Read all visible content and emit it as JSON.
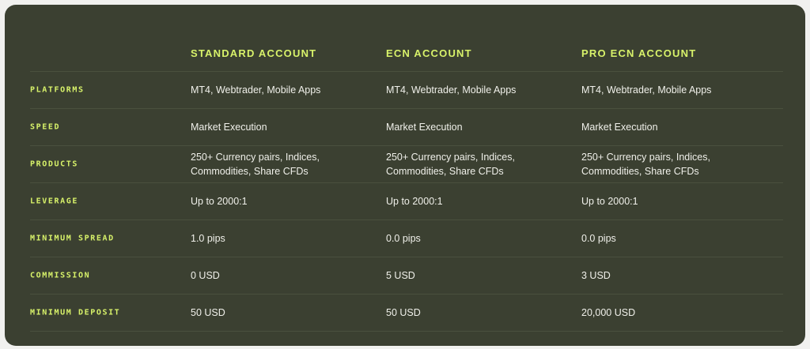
{
  "columns": [
    "STANDARD ACCOUNT",
    "ECN ACCOUNT",
    "PRO ECN ACCOUNT"
  ],
  "rows": [
    {
      "label": "PLATFORMS",
      "values": [
        "MT4, Webtrader, Mobile Apps",
        "MT4, Webtrader, Mobile Apps",
        "MT4, Webtrader, Mobile Apps"
      ]
    },
    {
      "label": "SPEED",
      "values": [
        "Market Execution",
        "Market Execution",
        "Market Execution"
      ]
    },
    {
      "label": "PRODUCTS",
      "values": [
        "250+ Currency pairs, Indices,\nCommodities, Share CFDs",
        "250+ Currency pairs, Indices,\nCommodities, Share CFDs",
        "250+ Currency pairs, Indices,\nCommodities, Share CFDs"
      ]
    },
    {
      "label": "LEVERAGE",
      "values": [
        "Up to 2000:1",
        "Up to 2000:1",
        "Up to 2000:1"
      ]
    },
    {
      "label": "MINIMUM SPREAD",
      "values": [
        "1.0 pips",
        "0.0 pips",
        "0.0 pips"
      ]
    },
    {
      "label": "COMMISSION",
      "values": [
        "0 USD",
        "5 USD",
        "3 USD"
      ]
    },
    {
      "label": "MINIMUM DEPOSIT",
      "values": [
        "50 USD",
        "50 USD",
        "20,000 USD"
      ]
    }
  ],
  "colors": {
    "panel_bg": "#3b4031",
    "accent": "#d8f26a",
    "text": "#f0f0ea"
  }
}
